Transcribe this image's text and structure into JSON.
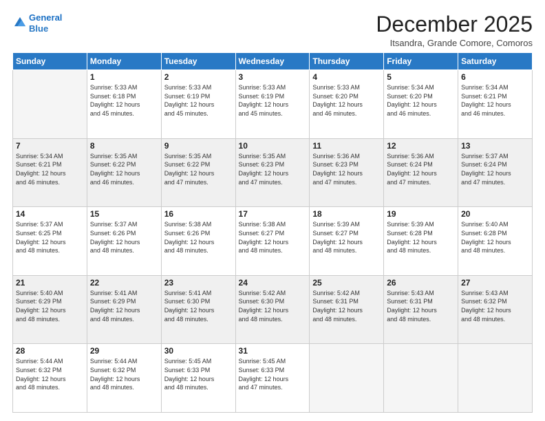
{
  "logo": {
    "line1": "General",
    "line2": "Blue"
  },
  "title": "December 2025",
  "location": "Itsandra, Grande Comore, Comoros",
  "days_of_week": [
    "Sunday",
    "Monday",
    "Tuesday",
    "Wednesday",
    "Thursday",
    "Friday",
    "Saturday"
  ],
  "weeks": [
    [
      {
        "num": "",
        "info": ""
      },
      {
        "num": "1",
        "info": "Sunrise: 5:33 AM\nSunset: 6:18 PM\nDaylight: 12 hours\nand 45 minutes."
      },
      {
        "num": "2",
        "info": "Sunrise: 5:33 AM\nSunset: 6:19 PM\nDaylight: 12 hours\nand 45 minutes."
      },
      {
        "num": "3",
        "info": "Sunrise: 5:33 AM\nSunset: 6:19 PM\nDaylight: 12 hours\nand 45 minutes."
      },
      {
        "num": "4",
        "info": "Sunrise: 5:33 AM\nSunset: 6:20 PM\nDaylight: 12 hours\nand 46 minutes."
      },
      {
        "num": "5",
        "info": "Sunrise: 5:34 AM\nSunset: 6:20 PM\nDaylight: 12 hours\nand 46 minutes."
      },
      {
        "num": "6",
        "info": "Sunrise: 5:34 AM\nSunset: 6:21 PM\nDaylight: 12 hours\nand 46 minutes."
      }
    ],
    [
      {
        "num": "7",
        "info": "Sunrise: 5:34 AM\nSunset: 6:21 PM\nDaylight: 12 hours\nand 46 minutes."
      },
      {
        "num": "8",
        "info": "Sunrise: 5:35 AM\nSunset: 6:22 PM\nDaylight: 12 hours\nand 46 minutes."
      },
      {
        "num": "9",
        "info": "Sunrise: 5:35 AM\nSunset: 6:22 PM\nDaylight: 12 hours\nand 47 minutes."
      },
      {
        "num": "10",
        "info": "Sunrise: 5:35 AM\nSunset: 6:23 PM\nDaylight: 12 hours\nand 47 minutes."
      },
      {
        "num": "11",
        "info": "Sunrise: 5:36 AM\nSunset: 6:23 PM\nDaylight: 12 hours\nand 47 minutes."
      },
      {
        "num": "12",
        "info": "Sunrise: 5:36 AM\nSunset: 6:24 PM\nDaylight: 12 hours\nand 47 minutes."
      },
      {
        "num": "13",
        "info": "Sunrise: 5:37 AM\nSunset: 6:24 PM\nDaylight: 12 hours\nand 47 minutes."
      }
    ],
    [
      {
        "num": "14",
        "info": "Sunrise: 5:37 AM\nSunset: 6:25 PM\nDaylight: 12 hours\nand 48 minutes."
      },
      {
        "num": "15",
        "info": "Sunrise: 5:37 AM\nSunset: 6:26 PM\nDaylight: 12 hours\nand 48 minutes."
      },
      {
        "num": "16",
        "info": "Sunrise: 5:38 AM\nSunset: 6:26 PM\nDaylight: 12 hours\nand 48 minutes."
      },
      {
        "num": "17",
        "info": "Sunrise: 5:38 AM\nSunset: 6:27 PM\nDaylight: 12 hours\nand 48 minutes."
      },
      {
        "num": "18",
        "info": "Sunrise: 5:39 AM\nSunset: 6:27 PM\nDaylight: 12 hours\nand 48 minutes."
      },
      {
        "num": "19",
        "info": "Sunrise: 5:39 AM\nSunset: 6:28 PM\nDaylight: 12 hours\nand 48 minutes."
      },
      {
        "num": "20",
        "info": "Sunrise: 5:40 AM\nSunset: 6:28 PM\nDaylight: 12 hours\nand 48 minutes."
      }
    ],
    [
      {
        "num": "21",
        "info": "Sunrise: 5:40 AM\nSunset: 6:29 PM\nDaylight: 12 hours\nand 48 minutes."
      },
      {
        "num": "22",
        "info": "Sunrise: 5:41 AM\nSunset: 6:29 PM\nDaylight: 12 hours\nand 48 minutes."
      },
      {
        "num": "23",
        "info": "Sunrise: 5:41 AM\nSunset: 6:30 PM\nDaylight: 12 hours\nand 48 minutes."
      },
      {
        "num": "24",
        "info": "Sunrise: 5:42 AM\nSunset: 6:30 PM\nDaylight: 12 hours\nand 48 minutes."
      },
      {
        "num": "25",
        "info": "Sunrise: 5:42 AM\nSunset: 6:31 PM\nDaylight: 12 hours\nand 48 minutes."
      },
      {
        "num": "26",
        "info": "Sunrise: 5:43 AM\nSunset: 6:31 PM\nDaylight: 12 hours\nand 48 minutes."
      },
      {
        "num": "27",
        "info": "Sunrise: 5:43 AM\nSunset: 6:32 PM\nDaylight: 12 hours\nand 48 minutes."
      }
    ],
    [
      {
        "num": "28",
        "info": "Sunrise: 5:44 AM\nSunset: 6:32 PM\nDaylight: 12 hours\nand 48 minutes."
      },
      {
        "num": "29",
        "info": "Sunrise: 5:44 AM\nSunset: 6:32 PM\nDaylight: 12 hours\nand 48 minutes."
      },
      {
        "num": "30",
        "info": "Sunrise: 5:45 AM\nSunset: 6:33 PM\nDaylight: 12 hours\nand 48 minutes."
      },
      {
        "num": "31",
        "info": "Sunrise: 5:45 AM\nSunset: 6:33 PM\nDaylight: 12 hours\nand 47 minutes."
      },
      {
        "num": "",
        "info": ""
      },
      {
        "num": "",
        "info": ""
      },
      {
        "num": "",
        "info": ""
      }
    ]
  ]
}
